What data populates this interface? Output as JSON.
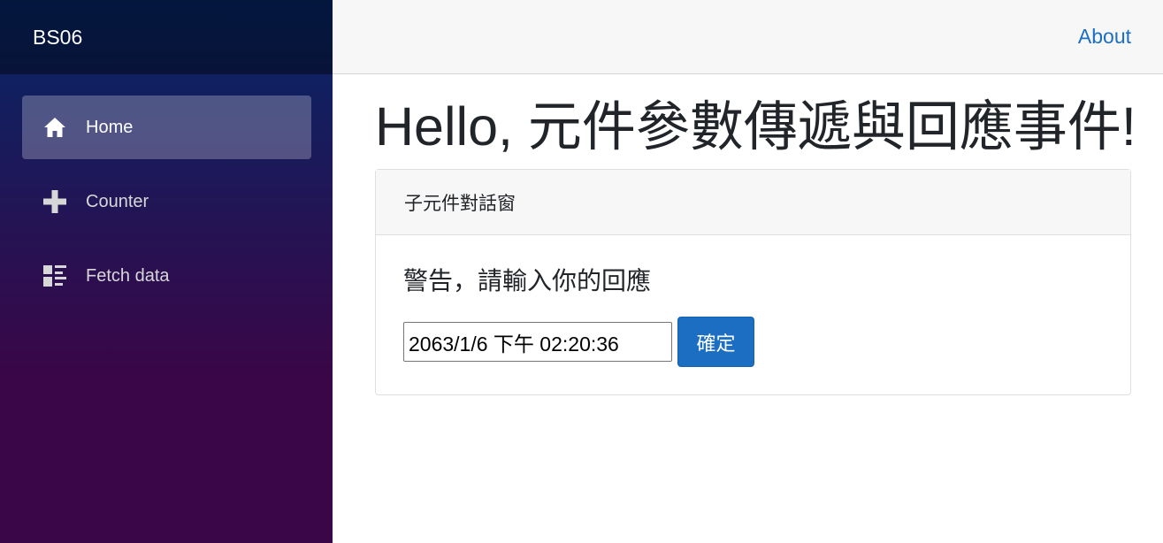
{
  "sidebar": {
    "brand": "BS06",
    "items": [
      {
        "label": "Home",
        "icon": "home-icon",
        "active": true
      },
      {
        "label": "Counter",
        "icon": "plus-icon",
        "active": false
      },
      {
        "label": "Fetch data",
        "icon": "list-rich-icon",
        "active": false
      }
    ]
  },
  "header": {
    "about_label": "About"
  },
  "main": {
    "title": "Hello, 元件參數傳遞與回應事件!",
    "card": {
      "header": "子元件對話窗",
      "text": "警告，請輸入你的回應",
      "input_value": "2063/1/6 下午 02:20:36",
      "button_label": "確定"
    }
  },
  "colors": {
    "accent": "#1b6ec2",
    "sidebar_top": "#052767",
    "sidebar_bottom": "#3a0647"
  }
}
